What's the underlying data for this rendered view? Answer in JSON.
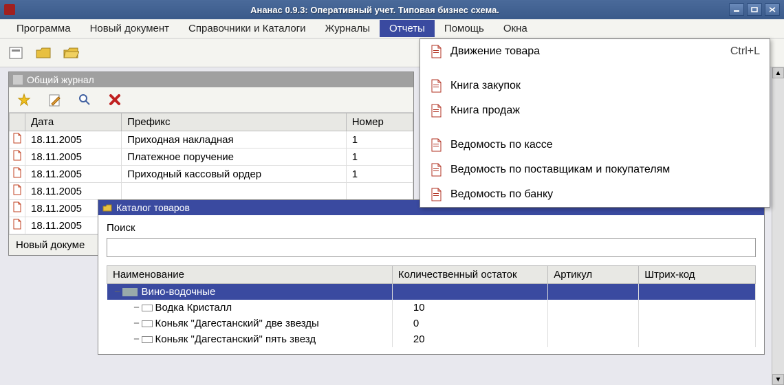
{
  "window": {
    "title": "Ананас 0.9.3: Оперативный учет. Типовая бизнес схема."
  },
  "menu": {
    "items": [
      "Программа",
      "Новый документ",
      "Справочники и Каталоги",
      "Журналы",
      "Отчеты",
      "Помощь",
      "Окна"
    ],
    "active_index": 4
  },
  "dropdown": {
    "groups": [
      [
        {
          "label": "Движение товара",
          "shortcut": "Ctrl+L"
        }
      ],
      [
        {
          "label": "Книга закупок"
        },
        {
          "label": "Книга продаж"
        }
      ],
      [
        {
          "label": "Ведомость по кассе"
        },
        {
          "label": "Ведомость по поставщикам и покупателям"
        },
        {
          "label": "Ведомость по банку"
        }
      ]
    ]
  },
  "journal": {
    "title": "Общий журнал",
    "columns": [
      "",
      "Дата",
      "Префикс",
      "Номер"
    ],
    "rows": [
      {
        "date": "18.11.2005",
        "prefix": "Приходная накладная",
        "number": "1"
      },
      {
        "date": "18.11.2005",
        "prefix": "Платежное поручение",
        "number": "1"
      },
      {
        "date": "18.11.2005",
        "prefix": "Приходный кассовый ордер",
        "number": "1"
      },
      {
        "date": "18.11.2005",
        "prefix": "",
        "number": ""
      },
      {
        "date": "18.11.2005",
        "prefix": "",
        "number": ""
      },
      {
        "date": "18.11.2005",
        "prefix": "",
        "number": ""
      }
    ],
    "status": "Новый докуме"
  },
  "catalog": {
    "title": "Каталог товаров",
    "search_label": "Поиск",
    "search_value": "",
    "columns": [
      "Наименование",
      "Количественный остаток",
      "Артикул",
      "Штрих-код"
    ],
    "rows": [
      {
        "type": "group",
        "name": "Вино-водочные",
        "qty": "",
        "art": "",
        "bar": ""
      },
      {
        "type": "item",
        "name": "Водка Кристалл",
        "qty": "10",
        "art": "",
        "bar": ""
      },
      {
        "type": "item",
        "name": "Коньяк \"Дагестанский\" две звезды",
        "qty": "0",
        "art": "",
        "bar": ""
      },
      {
        "type": "item",
        "name": "Коньяк \"Дагестанский\" пять звезд",
        "qty": "20",
        "art": "",
        "bar": ""
      }
    ]
  }
}
